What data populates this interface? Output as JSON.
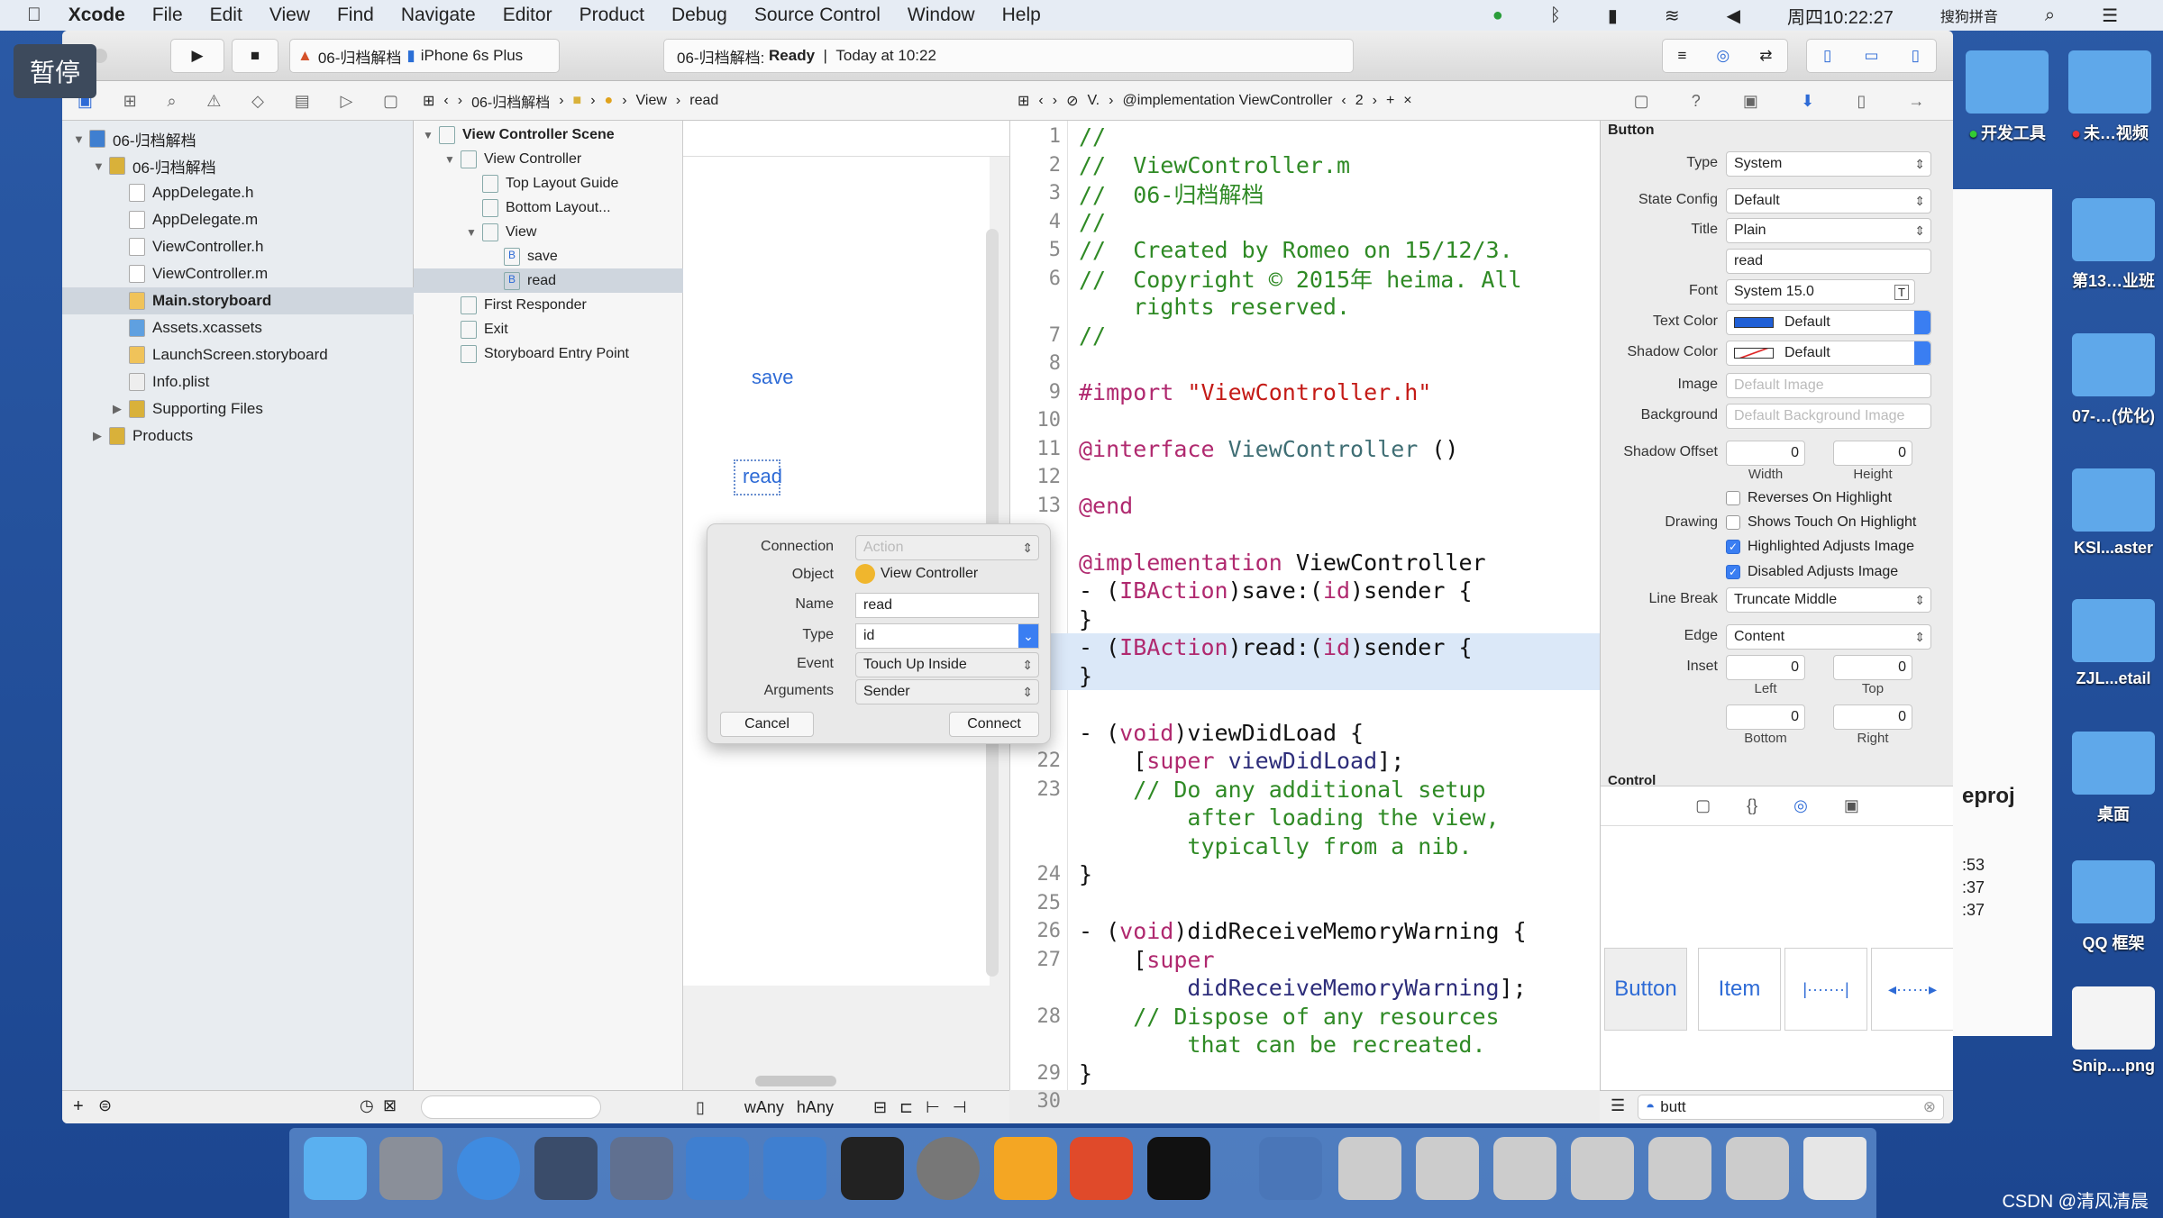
{
  "menubar": {
    "apple": "",
    "items": [
      "Xcode",
      "File",
      "Edit",
      "View",
      "Find",
      "Navigate",
      "Editor",
      "Product",
      "Debug",
      "Source Control",
      "Window",
      "Help"
    ],
    "clock": "周四10:22:27",
    "ime": "搜狗拼音"
  },
  "overlay": {
    "pause": "暂停"
  },
  "toolbar": {
    "scheme": "06-归档解档",
    "device": "iPhone 6s Plus",
    "status_project": "06-归档解档:",
    "status_state": "Ready",
    "status_time": "Today at 10:22"
  },
  "jumpbar": {
    "left": [
      "06-归档解档",
      "View",
      "read"
    ],
    "right": [
      "V.",
      "@implementation ViewController",
      "2"
    ]
  },
  "navigator": {
    "items": [
      {
        "label": "06-归档解档",
        "depth": 0,
        "kind": "project",
        "disclosure": "▼"
      },
      {
        "label": "06-归档解档",
        "depth": 1,
        "kind": "folder",
        "disclosure": "▼"
      },
      {
        "label": "AppDelegate.h",
        "depth": 2,
        "kind": "h"
      },
      {
        "label": "AppDelegate.m",
        "depth": 2,
        "kind": "m"
      },
      {
        "label": "ViewController.h",
        "depth": 2,
        "kind": "h"
      },
      {
        "label": "ViewController.m",
        "depth": 2,
        "kind": "m"
      },
      {
        "label": "Main.storyboard",
        "depth": 2,
        "kind": "sb",
        "selected": true
      },
      {
        "label": "Assets.xcassets",
        "depth": 2,
        "kind": "assets"
      },
      {
        "label": "LaunchScreen.storyboard",
        "depth": 2,
        "kind": "sb"
      },
      {
        "label": "Info.plist",
        "depth": 2,
        "kind": "plist"
      },
      {
        "label": "Supporting Files",
        "depth": 2,
        "kind": "folder",
        "disclosure": "▶"
      },
      {
        "label": "Products",
        "depth": 1,
        "kind": "folder",
        "disclosure": "▶"
      }
    ]
  },
  "outline": {
    "items": [
      {
        "label": "View Controller Scene",
        "depth": 0,
        "disclosure": "▼",
        "bold": true
      },
      {
        "label": "View Controller",
        "depth": 1,
        "disclosure": "▼"
      },
      {
        "label": "Top Layout Guide",
        "depth": 2
      },
      {
        "label": "Bottom Layout...",
        "depth": 2
      },
      {
        "label": "View",
        "depth": 2,
        "disclosure": "▼"
      },
      {
        "label": "save",
        "depth": 3,
        "badge": "B"
      },
      {
        "label": "read",
        "depth": 3,
        "badge": "B",
        "selected": true
      },
      {
        "label": "First Responder",
        "depth": 1
      },
      {
        "label": "Exit",
        "depth": 1
      },
      {
        "label": "Storyboard Entry Point",
        "depth": 1
      }
    ]
  },
  "canvas": {
    "save": "save",
    "read": "read",
    "size_w": "wAny",
    "size_h": "hAny"
  },
  "popover": {
    "connection_label": "Connection",
    "connection": "Action",
    "object_label": "Object",
    "object": "View Controller",
    "name_label": "Name",
    "name": "read",
    "type_label": "Type",
    "type": "id",
    "event_label": "Event",
    "event": "Touch Up Inside",
    "arguments_label": "Arguments",
    "arguments": "Sender",
    "cancel": "Cancel",
    "connect": "Connect"
  },
  "code": [
    {
      "n": "1",
      "s": [
        [
          "//",
          "comment"
        ]
      ]
    },
    {
      "n": "2",
      "s": [
        [
          "//  ViewController.m",
          "comment"
        ]
      ]
    },
    {
      "n": "3",
      "s": [
        [
          "//  06-归档解档",
          "comment"
        ]
      ]
    },
    {
      "n": "4",
      "s": [
        [
          "//",
          "comment"
        ]
      ]
    },
    {
      "n": "5",
      "s": [
        [
          "//  Created by Romeo on 15/12/3.",
          "comment"
        ]
      ]
    },
    {
      "n": "6",
      "s": [
        [
          "//  Copyright © 2015年 heima. All",
          "comment"
        ]
      ]
    },
    {
      "n": "",
      "s": [
        [
          "    rights reserved.",
          "comment"
        ]
      ]
    },
    {
      "n": "7",
      "s": [
        [
          "//",
          "comment"
        ]
      ]
    },
    {
      "n": "8",
      "s": []
    },
    {
      "n": "9",
      "s": [
        [
          "#import ",
          "kw"
        ],
        [
          "\"ViewController.h\"",
          "str"
        ]
      ]
    },
    {
      "n": "10",
      "s": []
    },
    {
      "n": "11",
      "s": [
        [
          "@interface ",
          "kw"
        ],
        [
          "ViewController",
          "cls"
        ],
        [
          " ()",
          "plain"
        ]
      ]
    },
    {
      "n": "12",
      "s": []
    },
    {
      "n": "13",
      "s": [
        [
          "@end",
          "kw"
        ]
      ]
    },
    {
      "n": "",
      "s": []
    },
    {
      "n": "",
      "s": [
        [
          "@implementation ",
          "kw"
        ],
        [
          "ViewController",
          "plain"
        ]
      ]
    },
    {
      "n": "",
      "s": [
        [
          "- (",
          "plain"
        ],
        [
          "IBAction",
          "kw"
        ],
        [
          ")save:(",
          "plain"
        ],
        [
          "id",
          "kw"
        ],
        [
          ")sender {",
          "plain"
        ]
      ]
    },
    {
      "n": "",
      "s": [
        [
          "}",
          "plain"
        ]
      ]
    },
    {
      "n": "",
      "s": [
        [
          "- (",
          "plain"
        ],
        [
          "IBAction",
          "kw"
        ],
        [
          ")read:(",
          "plain"
        ],
        [
          "id",
          "kw"
        ],
        [
          ")sender {",
          "plain"
        ]
      ],
      "hl": true
    },
    {
      "n": "",
      "s": [
        [
          "}",
          "plain"
        ]
      ],
      "hl": true
    },
    {
      "n": "",
      "s": []
    },
    {
      "n": "",
      "s": [
        [
          "- (",
          "plain"
        ],
        [
          "void",
          "kw"
        ],
        [
          ")viewDidLoad {",
          "plain"
        ]
      ]
    },
    {
      "n": "22",
      "s": [
        [
          "    [",
          "plain"
        ],
        [
          "super",
          "kw"
        ],
        [
          " viewDidLoad",
          "meth"
        ],
        [
          "];",
          "plain"
        ]
      ]
    },
    {
      "n": "23",
      "s": [
        [
          "    // Do any additional setup",
          "comment"
        ]
      ]
    },
    {
      "n": "",
      "s": [
        [
          "        after loading the view,",
          "comment"
        ]
      ]
    },
    {
      "n": "",
      "s": [
        [
          "        typically from a nib.",
          "comment"
        ]
      ]
    },
    {
      "n": "24",
      "s": [
        [
          "}",
          "plain"
        ]
      ]
    },
    {
      "n": "25",
      "s": []
    },
    {
      "n": "26",
      "s": [
        [
          "- (",
          "plain"
        ],
        [
          "void",
          "kw"
        ],
        [
          ")didReceiveMemoryWarning {",
          "plain"
        ]
      ]
    },
    {
      "n": "27",
      "s": [
        [
          "    [",
          "plain"
        ],
        [
          "super",
          "kw"
        ]
      ]
    },
    {
      "n": "",
      "s": [
        [
          "        didReceiveMemoryWarning",
          "meth"
        ],
        [
          "];",
          "plain"
        ]
      ]
    },
    {
      "n": "28",
      "s": [
        [
          "    // Dispose of any resources",
          "comment"
        ]
      ]
    },
    {
      "n": "",
      "s": [
        [
          "        that can be recreated.",
          "comment"
        ]
      ]
    },
    {
      "n": "29",
      "s": [
        [
          "}",
          "plain"
        ]
      ]
    },
    {
      "n": "30",
      "s": []
    }
  ],
  "inspector": {
    "section": "Button",
    "type_label": "Type",
    "type": "System",
    "state_label": "State Config",
    "state": "Default",
    "title_label": "Title",
    "title": "Plain",
    "title_text": "read",
    "font_label": "Font",
    "font": "System 15.0",
    "text_color_label": "Text Color",
    "text_color": "Default",
    "shadow_color_label": "Shadow Color",
    "shadow_color": "Default",
    "image_label": "Image",
    "image_placeholder": "Default Image",
    "background_label": "Background",
    "background_placeholder": "Default Background Image",
    "shadow_offset_label": "Shadow Offset",
    "shadow_w": "0",
    "shadow_h": "0",
    "width_label": "Width",
    "height_label": "Height",
    "reverses": "Reverses On Highlight",
    "drawing_label": "Drawing",
    "shows_touch": "Shows Touch On Highlight",
    "highlighted_adjusts": "Highlighted Adjusts Image",
    "disabled_adjusts": "Disabled Adjusts Image",
    "reverses_checked": false,
    "shows_touch_checked": false,
    "highlighted_checked": true,
    "disabled_checked": true,
    "line_break_label": "Line Break",
    "line_break": "Truncate Middle",
    "edge_label": "Edge",
    "edge": "Content",
    "inset_label": "Inset",
    "inset_left": "0",
    "inset_top": "0",
    "inset_bottom": "0",
    "inset_right": "0",
    "left_label": "Left",
    "top_label": "Top",
    "bottom_label": "Bottom",
    "right_label": "Right",
    "control_section": "Control",
    "text_color_hex": "#1f5fd6"
  },
  "library": {
    "tiles": [
      "Button",
      "Item"
    ],
    "search": "butt"
  },
  "desktop": {
    "icons": [
      "开发工具",
      "未…视频",
      "第13…业班",
      "07-…(优化)",
      "KSI...aster",
      "ZJL...etail",
      "桌面",
      "QQ 框架",
      "Snip....png"
    ],
    "partial_text": [
      "eproj",
      ":53",
      ":37",
      ":37"
    ]
  },
  "watermark": "CSDN @清风清晨"
}
